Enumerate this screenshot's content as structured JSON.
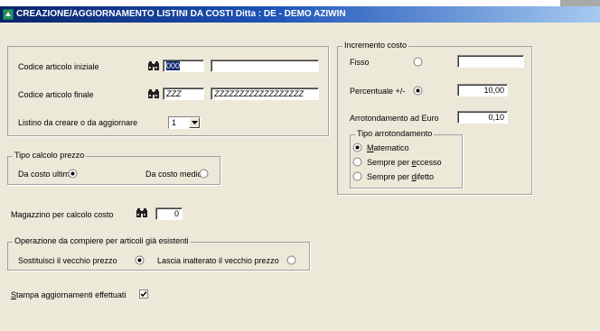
{
  "window": {
    "title": "CREAZIONE/AGGIORNAMENTO LISTINI DA COSTI  Ditta : DE - DEMO AZIWIN"
  },
  "articoli": {
    "codice_iniziale_label": "Codice articolo iniziale",
    "codice_iniziale_value": "000",
    "codice_iniziale_desc": "",
    "codice_finale_label": "Codice articolo finale",
    "codice_finale_value": "ZZZ",
    "codice_finale_desc": "ZZZZZZZZZZZZZZZZZZ",
    "listino_label": "Listino da creare o da aggiornare",
    "listino_value": "1"
  },
  "tipo_calcolo": {
    "legend": "Tipo calcolo prezzo",
    "costo_ultimo_label": "Da costo ultimo",
    "costo_medio_label": "Da costo medio",
    "selected": "costo_ultimo"
  },
  "magazzino": {
    "label": "Magazzino per calcolo costo",
    "value": "0"
  },
  "operazione": {
    "legend": "Operazione da compiere per articoli già esistenti",
    "sostituisci_label": "Sostituisci il vecchio prezzo",
    "lascia_label": "Lascia inalterato il vecchio prezzo",
    "selected": "sostituisci"
  },
  "stampa": {
    "pre": "",
    "accel": "S",
    "rest": "tampa aggiornamenti effettuati",
    "checked": true
  },
  "incremento": {
    "legend": "Incremento costo",
    "fisso_label": "Fisso",
    "fisso_value": "",
    "percentuale_label": "Percentuale +/-",
    "percentuale_value": "10,00",
    "arrotondamento_label": "Arrotondamento ad Euro",
    "arrotondamento_value": "0,10",
    "selected": "percentuale"
  },
  "tipo_arrotondamento": {
    "legend": "Tipo arrotondamento",
    "matematico": {
      "pre": "",
      "accel": "M",
      "rest": "atematico"
    },
    "eccesso": {
      "pre": "Sempre per ",
      "accel": "e",
      "rest": "ccesso"
    },
    "difetto": {
      "pre": "Sempre per ",
      "accel": "d",
      "rest": "ifetto"
    },
    "selected": "matematico"
  },
  "colors": {
    "titlebar_start": "#0a246a",
    "titlebar_end": "#a6caf0",
    "background": "#ece9d8",
    "selection": "#0a246a"
  }
}
